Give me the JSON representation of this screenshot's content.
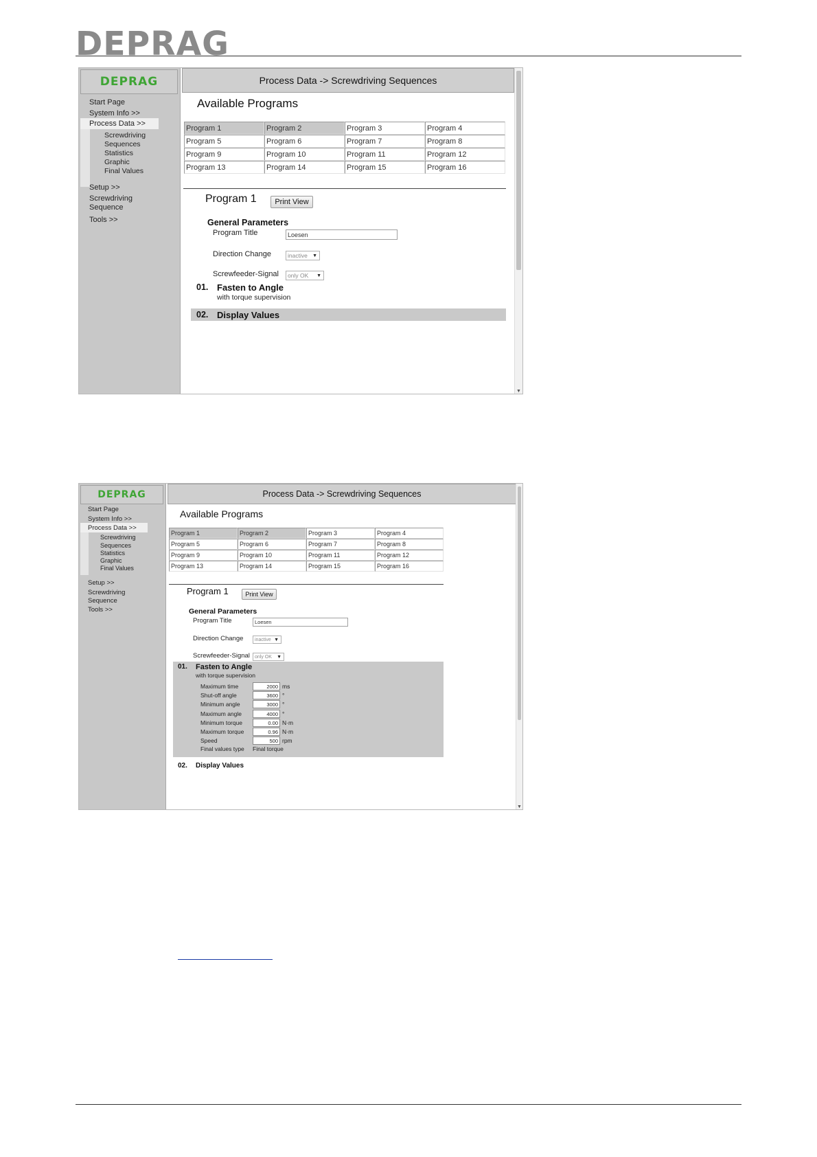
{
  "document": {
    "brand": "DEPRAG"
  },
  "screens": [
    {
      "logo": "DEPRAG",
      "title": "Process Data -> Screwdriving Sequences",
      "nav": {
        "start_page": "Start Page",
        "system_info": "System Info >>",
        "process_data": "Process Data >>",
        "sub_items": [
          "Screwdriving",
          "Sequences",
          "Statistics",
          "Graphic",
          "Final Values"
        ],
        "setup": "Setup >>",
        "screwdriving_sequence_1": "Screwdriving",
        "screwdriving_sequence_2": "Sequence",
        "tools": "Tools >>"
      },
      "available_programs_heading": "Available Programs",
      "programs": [
        "Program 1",
        "Program 2",
        "Program 3",
        "Program 4",
        "Program 5",
        "Program 6",
        "Program 7",
        "Program 8",
        "Program 9",
        "Program 10",
        "Program 11",
        "Program 12",
        "Program 13",
        "Program 14",
        "Program 15",
        "Program 16"
      ],
      "selected_programs": [
        0,
        1
      ],
      "program_heading": "Program 1",
      "print_view": "Print View",
      "general_parameters": "General Parameters",
      "program_title_label": "Program Title",
      "program_title_value": "Loesen",
      "direction_change_label": "Direction Change",
      "direction_change_value": "inactive",
      "screwfeeder_label": "Screwfeeder-Signal",
      "screwfeeder_value": "only OK",
      "step1_number": "01.",
      "step1_title": "Fasten to Angle",
      "step1_sub": "with torque supervision",
      "step2_number": "02.",
      "step2_title": "Display Values"
    },
    {
      "logo": "DEPRAG",
      "title": "Process Data -> Screwdriving Sequences",
      "nav": {
        "start_page": "Start Page",
        "system_info": "System Info >>",
        "process_data": "Process Data >>",
        "sub_items": [
          "Screwdriving",
          "Sequences",
          "Statistics",
          "Graphic",
          "Final Values"
        ],
        "setup": "Setup >>",
        "screwdriving_sequence_1": "Screwdriving",
        "screwdriving_sequence_2": "Sequence",
        "tools": "Tools >>"
      },
      "available_programs_heading": "Available Programs",
      "programs": [
        "Program 1",
        "Program 2",
        "Program 3",
        "Program 4",
        "Program 5",
        "Program 6",
        "Program 7",
        "Program 8",
        "Program 9",
        "Program 10",
        "Program 11",
        "Program 12",
        "Program 13",
        "Program 14",
        "Program 15",
        "Program 16"
      ],
      "selected_programs": [
        0,
        1
      ],
      "program_heading": "Program 1",
      "print_view": "Print View",
      "general_parameters": "General Parameters",
      "program_title_label": "Program Title",
      "program_title_value": "Loesen",
      "direction_change_label": "Direction Change",
      "direction_change_value": "inactive",
      "screwfeeder_label": "Screwfeeder-Signal",
      "screwfeeder_value": "only OK",
      "step1_number": "01.",
      "step1_title": "Fasten to Angle",
      "step1_sub": "with torque supervision",
      "step1_params": [
        {
          "name": "Maximum time",
          "value": "2000",
          "unit": "ms"
        },
        {
          "name": "Shut-off angle",
          "value": "3600",
          "unit": "°"
        },
        {
          "name": "Minimum angle",
          "value": "3000",
          "unit": "°"
        },
        {
          "name": "Maximum angle",
          "value": "4000",
          "unit": "°"
        },
        {
          "name": "Minimum torque",
          "value": "0.00",
          "unit": "N·m"
        },
        {
          "name": "Maximum torque",
          "value": "0.96",
          "unit": "N·m"
        },
        {
          "name": "Speed",
          "value": "500",
          "unit": "rpm"
        }
      ],
      "final_values_type_label": "Final values type",
      "final_values_type_value": "Final torque",
      "step2_number": "02.",
      "step2_title": "Display Values"
    }
  ]
}
